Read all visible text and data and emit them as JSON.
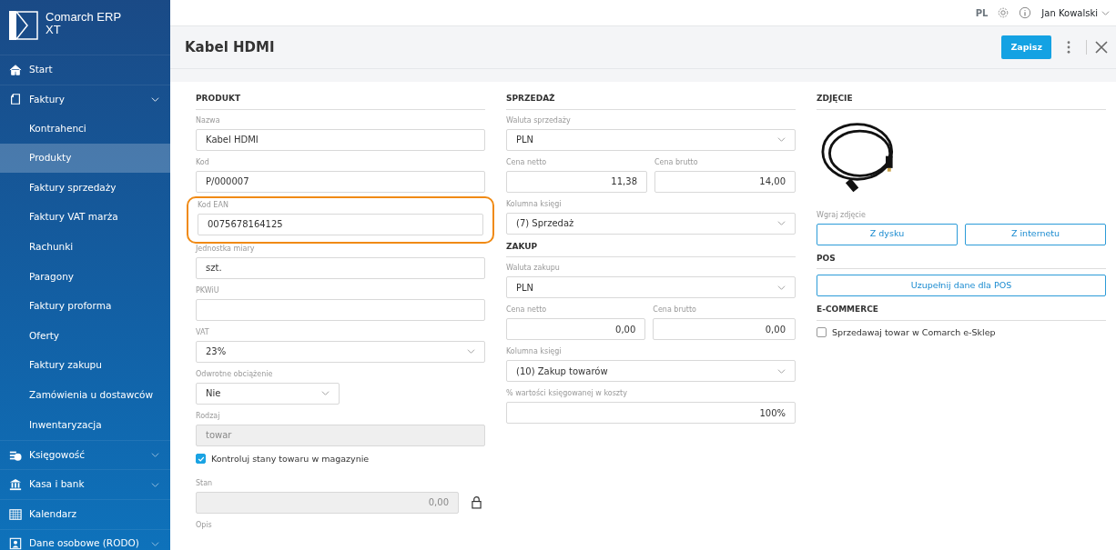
{
  "brand": {
    "line1": "Comarch ERP",
    "line2": "XT"
  },
  "sidebar": {
    "items": [
      {
        "label": "Start",
        "selected": false
      },
      {
        "label": "Faktury",
        "expanded": true,
        "selected": false,
        "children": [
          {
            "label": "Kontrahenci",
            "selected": false
          },
          {
            "label": "Produkty",
            "selected": true
          },
          {
            "label": "Faktury sprzedaży",
            "selected": false
          },
          {
            "label": "Faktury VAT marża",
            "selected": false
          },
          {
            "label": "Rachunki",
            "selected": false
          },
          {
            "label": "Paragony",
            "selected": false
          },
          {
            "label": "Faktury proforma",
            "selected": false
          },
          {
            "label": "Oferty",
            "selected": false
          },
          {
            "label": "Faktury zakupu",
            "selected": false
          },
          {
            "label": "Zamówienia u dostawców",
            "selected": false
          },
          {
            "label": "Inwentaryzacja",
            "selected": false
          }
        ]
      },
      {
        "label": "Księgowość",
        "expanded": false,
        "selected": false
      },
      {
        "label": "Kasa i bank",
        "expanded": false,
        "selected": false
      },
      {
        "label": "Kalendarz",
        "selected": false
      },
      {
        "label": "Dane osobowe (RODO)",
        "expanded": false,
        "selected": false
      }
    ]
  },
  "topbar": {
    "language": "PL",
    "user": "Jan Kowalski"
  },
  "header": {
    "title": "Kabel HDMI",
    "save_button": "Zapisz"
  },
  "columns": [
    [
      {
        "title": "PRODUKT",
        "fields": [
          {
            "kind": "text",
            "label": "Nazwa",
            "value": "Kabel HDMI"
          },
          {
            "kind": "text",
            "label": "Kod",
            "value": "P/000007"
          },
          {
            "kind": "text",
            "label": "Kod EAN",
            "value": "0075678164125",
            "highlighted": true
          },
          {
            "kind": "text",
            "label": "Jednostka miary",
            "value": "szt."
          },
          {
            "kind": "text",
            "label": "PKWiU"
          },
          {
            "kind": "select",
            "label": "VAT",
            "value": "23%"
          },
          {
            "kind": "select_short",
            "label": "Odwrotne obciążenie",
            "value": "Nie"
          },
          {
            "kind": "disabled",
            "label": "Rodzaj",
            "value": "towar"
          },
          {
            "kind": "checkbox",
            "label": "Kontroluj stany towaru w magazynie",
            "checked": true
          },
          {
            "kind": "locked",
            "label": "Stan",
            "value": "0,00"
          },
          {
            "kind": "label",
            "label": "Opis"
          }
        ]
      }
    ],
    [
      {
        "title": "SPRZEDAŻ",
        "fields": [
          {
            "kind": "select",
            "label": "Waluta sprzedaży",
            "value": "PLN"
          },
          {
            "kind": "pair",
            "items": [
              {
                "label": "Cena netto",
                "value": "11,38"
              },
              {
                "label": "Cena brutto",
                "value": "14,00"
              }
            ]
          },
          {
            "kind": "select",
            "label": "Kolumna księgi",
            "value": "(7) Sprzedaż"
          }
        ]
      },
      {
        "title": "ZAKUP",
        "fields": [
          {
            "kind": "select",
            "label": "Waluta zakupu",
            "value": "PLN"
          },
          {
            "kind": "pair",
            "items": [
              {
                "label": "Cena netto",
                "value": "0,00"
              },
              {
                "label": "Cena brutto",
                "value": "0,00"
              }
            ]
          },
          {
            "kind": "select",
            "label": "Kolumna księgi",
            "value": "(10) Zakup towarów"
          },
          {
            "kind": "number",
            "label": "% wartości księgowanej w koszty",
            "value": "100%"
          }
        ]
      }
    ],
    [
      {
        "title": "ZDJĘCIE",
        "fields": [
          {
            "kind": "photo"
          },
          {
            "kind": "buttons",
            "label": "Wgraj zdjęcie",
            "buttons": [
              "Z dysku",
              "Z internetu"
            ]
          }
        ]
      },
      {
        "title": "POS",
        "fields": [
          {
            "kind": "buttons",
            "buttons": [
              "Uzupełnij dane dla POS"
            ]
          }
        ]
      },
      {
        "title": "E-COMMERCE",
        "fields": [
          {
            "kind": "checkbox",
            "label": "Sprzedawaj towar w Comarch e-Sklep",
            "checked": false
          }
        ]
      }
    ]
  ]
}
